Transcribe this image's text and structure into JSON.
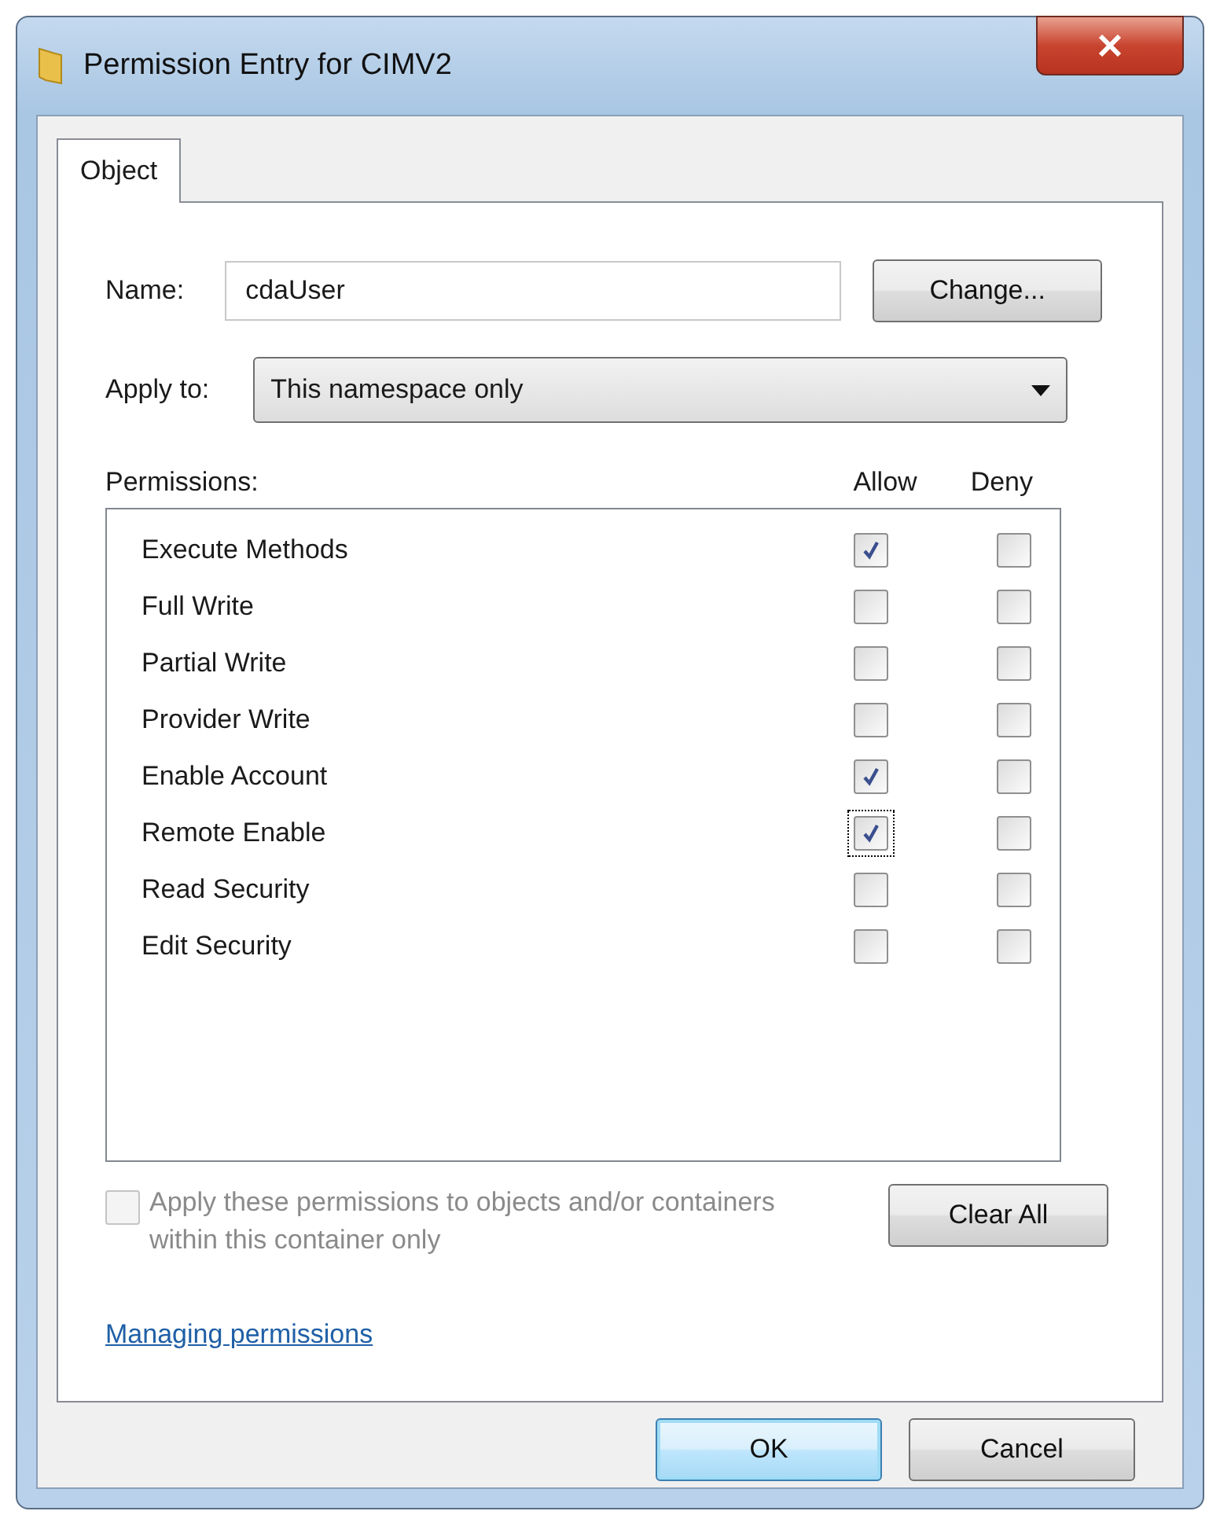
{
  "window": {
    "title": "Permission Entry for CIMV2"
  },
  "tabs": [
    {
      "label": "Object",
      "selected": true
    }
  ],
  "name_field": {
    "label": "Name:",
    "value": "cdaUser"
  },
  "change_button": "Change...",
  "apply_to": {
    "label": "Apply to:",
    "value": "This namespace only"
  },
  "permissions": {
    "label": "Permissions:",
    "columns": [
      "Allow",
      "Deny"
    ],
    "rows": [
      {
        "name": "Execute Methods",
        "allow": true,
        "deny": false,
        "focused": false
      },
      {
        "name": "Full Write",
        "allow": false,
        "deny": false,
        "focused": false
      },
      {
        "name": "Partial Write",
        "allow": false,
        "deny": false,
        "focused": false
      },
      {
        "name": "Provider Write",
        "allow": false,
        "deny": false,
        "focused": false
      },
      {
        "name": "Enable Account",
        "allow": true,
        "deny": false,
        "focused": false
      },
      {
        "name": "Remote Enable",
        "allow": true,
        "deny": false,
        "focused": true
      },
      {
        "name": "Read Security",
        "allow": false,
        "deny": false,
        "focused": false
      },
      {
        "name": "Edit Security",
        "allow": false,
        "deny": false,
        "focused": false
      }
    ]
  },
  "apply_checkbox": {
    "label": "Apply these permissions to objects and/or containers within this container only",
    "checked": false,
    "disabled": true
  },
  "clear_button": "Clear All",
  "link": "Managing permissions",
  "buttons": [
    {
      "label": "OK",
      "default": true
    },
    {
      "label": "Cancel",
      "default": false
    }
  ]
}
